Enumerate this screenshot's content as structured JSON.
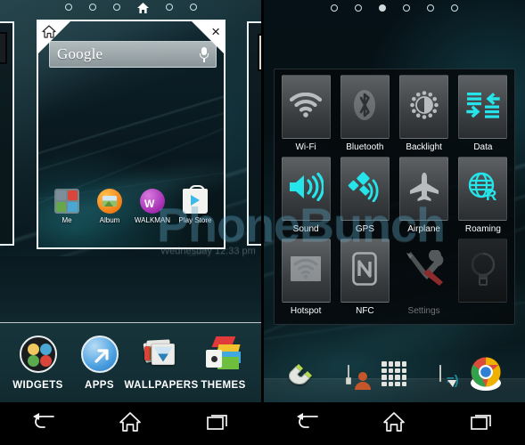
{
  "watermark": {
    "text": "PhoneBunch",
    "sub": "Wednesday 12:33 pm"
  },
  "left": {
    "page_indicator": {
      "count": 6,
      "active_index": 3,
      "active_is_home": true
    },
    "thumbnail": {
      "home_corner_icon": "home-icon",
      "close_corner_icon": "×",
      "search_widget": {
        "label": "Google",
        "mic_icon": "microphone-icon"
      },
      "apps": [
        {
          "label": "Me",
          "icon": "folder-icon"
        },
        {
          "label": "Album",
          "icon": "album-icon"
        },
        {
          "label": "WALKMAN",
          "icon": "walkman-icon"
        },
        {
          "label": "Play Store",
          "icon": "play-store-icon"
        }
      ]
    },
    "action_bar": [
      {
        "label": "WIDGETS",
        "icon": "widgets-icon"
      },
      {
        "label": "APPS",
        "icon": "apps-arrow-icon"
      },
      {
        "label": "WALLPAPERS",
        "icon": "wallpapers-icon"
      },
      {
        "label": "THEMES",
        "icon": "themes-icon"
      }
    ],
    "navbar": [
      {
        "name": "back",
        "icon": "back-arrow-icon"
      },
      {
        "name": "home",
        "icon": "home-icon"
      },
      {
        "name": "recents",
        "icon": "recents-icon"
      }
    ]
  },
  "right": {
    "page_indicator": {
      "count": 6,
      "active_index": 2,
      "active_is_home": false
    },
    "quick_settings": [
      {
        "label": "Wi-Fi",
        "icon": "wifi-icon",
        "state": "off",
        "tile": "normal"
      },
      {
        "label": "Bluetooth",
        "icon": "bluetooth-icon",
        "state": "off",
        "tile": "normal"
      },
      {
        "label": "Backlight",
        "icon": "backlight-icon",
        "state": "off",
        "tile": "normal"
      },
      {
        "label": "Data",
        "icon": "data-icon",
        "state": "on",
        "tile": "normal"
      },
      {
        "label": "Sound",
        "icon": "sound-icon",
        "state": "on",
        "tile": "normal"
      },
      {
        "label": "GPS",
        "icon": "gps-icon",
        "state": "on",
        "tile": "normal"
      },
      {
        "label": "Airplane",
        "icon": "airplane-icon",
        "state": "off",
        "tile": "normal"
      },
      {
        "label": "Roaming",
        "icon": "roaming-icon",
        "state": "on",
        "tile": "normal"
      },
      {
        "label": "Hotspot",
        "icon": "hotspot-icon",
        "state": "off",
        "tile": "normal"
      },
      {
        "label": "NFC",
        "icon": "nfc-icon",
        "state": "off",
        "tile": "normal"
      },
      {
        "label": "Settings",
        "icon": "settings-icon",
        "state": "dim",
        "tile": "flat"
      },
      {
        "label": "",
        "icon": "flashlight-icon",
        "state": "off",
        "tile": "dark"
      }
    ],
    "dock": [
      {
        "name": "phone",
        "icon": "phone-icon"
      },
      {
        "name": "contacts",
        "icon": "contacts-icon"
      },
      {
        "name": "app-drawer",
        "icon": "app-drawer-icon"
      },
      {
        "name": "messaging",
        "icon": "messaging-icon"
      },
      {
        "name": "chrome",
        "icon": "chrome-icon"
      }
    ],
    "navbar": [
      {
        "name": "back",
        "icon": "back-arrow-icon"
      },
      {
        "name": "home",
        "icon": "home-icon"
      },
      {
        "name": "recents",
        "icon": "recents-icon"
      }
    ]
  },
  "colors": {
    "accent_cyan": "#25e4ea",
    "tile_gray": "#b9bcbe",
    "action_bar_bg": "#17343b",
    "navbar_bg": "#000000"
  }
}
